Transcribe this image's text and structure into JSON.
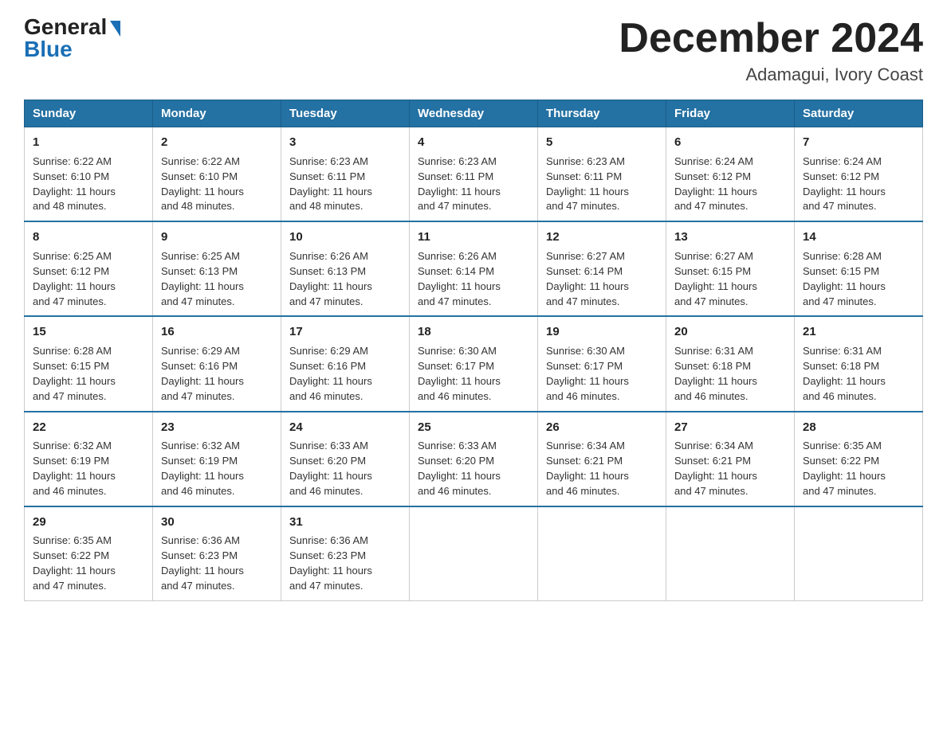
{
  "logo": {
    "general": "General",
    "blue": "Blue"
  },
  "title": {
    "month_year": "December 2024",
    "location": "Adamagui, Ivory Coast"
  },
  "days_of_week": [
    "Sunday",
    "Monday",
    "Tuesday",
    "Wednesday",
    "Thursday",
    "Friday",
    "Saturday"
  ],
  "weeks": [
    [
      {
        "day": "1",
        "sunrise": "6:22 AM",
        "sunset": "6:10 PM",
        "daylight": "11 hours and 48 minutes."
      },
      {
        "day": "2",
        "sunrise": "6:22 AM",
        "sunset": "6:10 PM",
        "daylight": "11 hours and 48 minutes."
      },
      {
        "day": "3",
        "sunrise": "6:23 AM",
        "sunset": "6:11 PM",
        "daylight": "11 hours and 48 minutes."
      },
      {
        "day": "4",
        "sunrise": "6:23 AM",
        "sunset": "6:11 PM",
        "daylight": "11 hours and 47 minutes."
      },
      {
        "day": "5",
        "sunrise": "6:23 AM",
        "sunset": "6:11 PM",
        "daylight": "11 hours and 47 minutes."
      },
      {
        "day": "6",
        "sunrise": "6:24 AM",
        "sunset": "6:12 PM",
        "daylight": "11 hours and 47 minutes."
      },
      {
        "day": "7",
        "sunrise": "6:24 AM",
        "sunset": "6:12 PM",
        "daylight": "11 hours and 47 minutes."
      }
    ],
    [
      {
        "day": "8",
        "sunrise": "6:25 AM",
        "sunset": "6:12 PM",
        "daylight": "11 hours and 47 minutes."
      },
      {
        "day": "9",
        "sunrise": "6:25 AM",
        "sunset": "6:13 PM",
        "daylight": "11 hours and 47 minutes."
      },
      {
        "day": "10",
        "sunrise": "6:26 AM",
        "sunset": "6:13 PM",
        "daylight": "11 hours and 47 minutes."
      },
      {
        "day": "11",
        "sunrise": "6:26 AM",
        "sunset": "6:14 PM",
        "daylight": "11 hours and 47 minutes."
      },
      {
        "day": "12",
        "sunrise": "6:27 AM",
        "sunset": "6:14 PM",
        "daylight": "11 hours and 47 minutes."
      },
      {
        "day": "13",
        "sunrise": "6:27 AM",
        "sunset": "6:15 PM",
        "daylight": "11 hours and 47 minutes."
      },
      {
        "day": "14",
        "sunrise": "6:28 AM",
        "sunset": "6:15 PM",
        "daylight": "11 hours and 47 minutes."
      }
    ],
    [
      {
        "day": "15",
        "sunrise": "6:28 AM",
        "sunset": "6:15 PM",
        "daylight": "11 hours and 47 minutes."
      },
      {
        "day": "16",
        "sunrise": "6:29 AM",
        "sunset": "6:16 PM",
        "daylight": "11 hours and 47 minutes."
      },
      {
        "day": "17",
        "sunrise": "6:29 AM",
        "sunset": "6:16 PM",
        "daylight": "11 hours and 46 minutes."
      },
      {
        "day": "18",
        "sunrise": "6:30 AM",
        "sunset": "6:17 PM",
        "daylight": "11 hours and 46 minutes."
      },
      {
        "day": "19",
        "sunrise": "6:30 AM",
        "sunset": "6:17 PM",
        "daylight": "11 hours and 46 minutes."
      },
      {
        "day": "20",
        "sunrise": "6:31 AM",
        "sunset": "6:18 PM",
        "daylight": "11 hours and 46 minutes."
      },
      {
        "day": "21",
        "sunrise": "6:31 AM",
        "sunset": "6:18 PM",
        "daylight": "11 hours and 46 minutes."
      }
    ],
    [
      {
        "day": "22",
        "sunrise": "6:32 AM",
        "sunset": "6:19 PM",
        "daylight": "11 hours and 46 minutes."
      },
      {
        "day": "23",
        "sunrise": "6:32 AM",
        "sunset": "6:19 PM",
        "daylight": "11 hours and 46 minutes."
      },
      {
        "day": "24",
        "sunrise": "6:33 AM",
        "sunset": "6:20 PM",
        "daylight": "11 hours and 46 minutes."
      },
      {
        "day": "25",
        "sunrise": "6:33 AM",
        "sunset": "6:20 PM",
        "daylight": "11 hours and 46 minutes."
      },
      {
        "day": "26",
        "sunrise": "6:34 AM",
        "sunset": "6:21 PM",
        "daylight": "11 hours and 46 minutes."
      },
      {
        "day": "27",
        "sunrise": "6:34 AM",
        "sunset": "6:21 PM",
        "daylight": "11 hours and 47 minutes."
      },
      {
        "day": "28",
        "sunrise": "6:35 AM",
        "sunset": "6:22 PM",
        "daylight": "11 hours and 47 minutes."
      }
    ],
    [
      {
        "day": "29",
        "sunrise": "6:35 AM",
        "sunset": "6:22 PM",
        "daylight": "11 hours and 47 minutes."
      },
      {
        "day": "30",
        "sunrise": "6:36 AM",
        "sunset": "6:23 PM",
        "daylight": "11 hours and 47 minutes."
      },
      {
        "day": "31",
        "sunrise": "6:36 AM",
        "sunset": "6:23 PM",
        "daylight": "11 hours and 47 minutes."
      },
      null,
      null,
      null,
      null
    ]
  ],
  "sunrise_label": "Sunrise:",
  "sunset_label": "Sunset:",
  "daylight_label": "Daylight:"
}
